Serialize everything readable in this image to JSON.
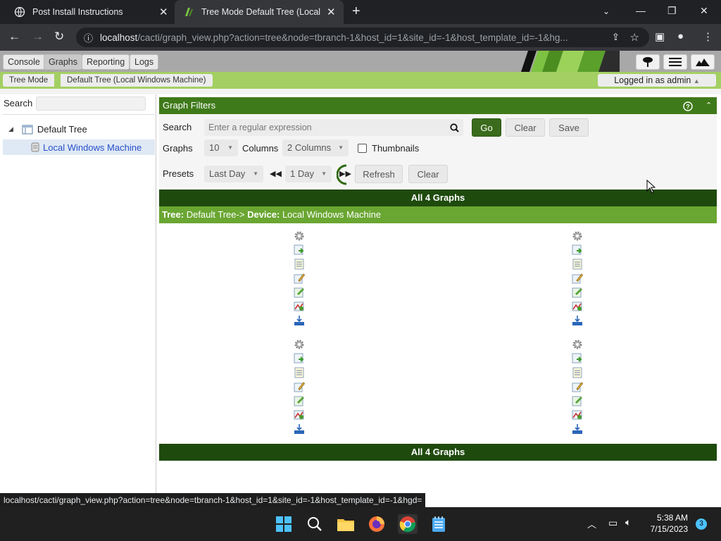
{
  "browser": {
    "tabs": [
      {
        "title": "Post Install Instructions"
      },
      {
        "title": "Tree Mode Default Tree (Local W"
      }
    ],
    "url_host": "localhost",
    "url_path": "/cacti/graph_view.php?action=tree&node=tbranch-1&host_id=1&site_id=-1&host_template_id=-1&hg..."
  },
  "cacti": {
    "menu": [
      "Console",
      "Graphs",
      "Reporting",
      "Logs"
    ],
    "breadcrumbs": [
      "Tree Mode",
      "Default Tree (Local Windows Machine)"
    ],
    "logged_in": "Logged in as admin"
  },
  "left": {
    "search_label": "Search",
    "tree_root": "Default Tree",
    "tree_leaf": "Local Windows Machine"
  },
  "filters": {
    "title": "Graph Filters",
    "search_label": "Search",
    "search_placeholder": "Enter a regular expression",
    "go": "Go",
    "clear": "Clear",
    "save": "Save",
    "graphs_label": "Graphs",
    "graphs_value": "10",
    "columns_label": "Columns",
    "columns_value": "2 Columns",
    "thumbnails_label": "Thumbnails",
    "presets_label": "Presets",
    "presets_value": "Last Day",
    "timespan_value": "1 Day",
    "refresh": "Refresh",
    "clear2": "Clear"
  },
  "graphs": {
    "header": "All 4 Graphs",
    "tree_label": "Tree:",
    "tree_value": "Default Tree->",
    "device_label": "Device:",
    "device_value": "Local Windows Machine",
    "footer": "All 4 Graphs"
  },
  "status_url": "localhost/cacti/graph_view.php?action=tree&node=tbranch-1&host_id=1&site_id=-1&host_template_id=-1&hgd=",
  "taskbar": {
    "time": "5:38 AM",
    "date": "7/15/2023",
    "notifications": "3"
  }
}
